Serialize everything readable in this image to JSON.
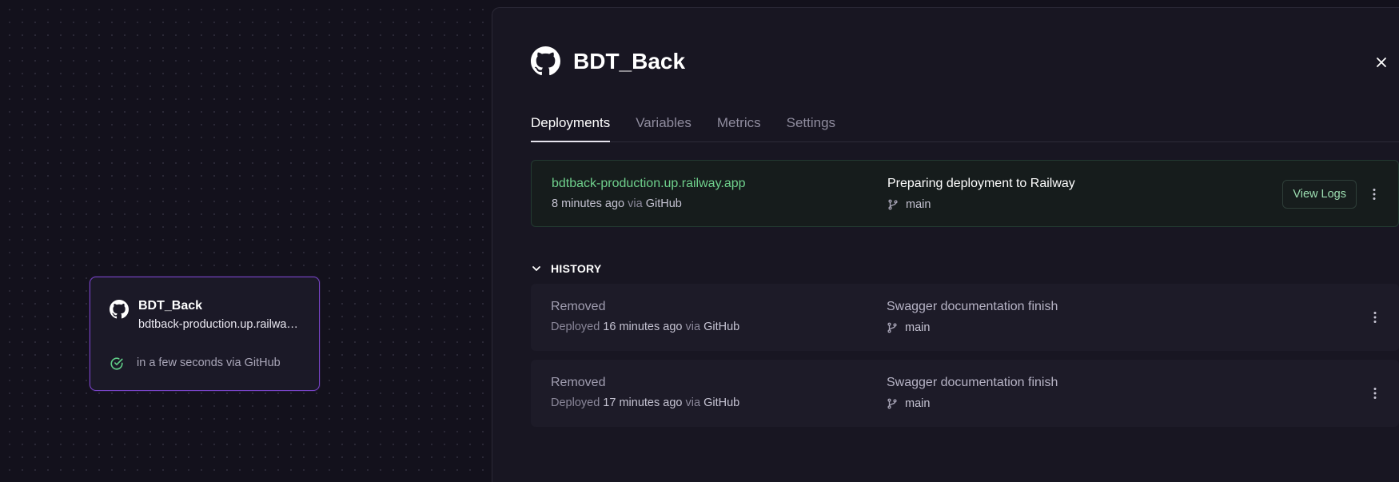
{
  "canvas": {
    "service_card": {
      "name": "BDT_Back",
      "url": "bdtback-production.up.railway.app",
      "status": "in a few seconds via GitHub",
      "icon": "github-icon",
      "status_icon": "check-circle-icon"
    }
  },
  "panel": {
    "title": "BDT_Back",
    "icon": "github-icon",
    "tabs": [
      {
        "label": "Deployments",
        "active": true
      },
      {
        "label": "Variables",
        "active": false
      },
      {
        "label": "Metrics",
        "active": false
      },
      {
        "label": "Settings",
        "active": false
      }
    ],
    "active_deployment": {
      "url": "bdtback-production.up.railway.app",
      "time": "8 minutes ago",
      "via_label": "via",
      "source": "GitHub",
      "message": "Preparing deployment to Railway",
      "branch": "main",
      "view_logs_label": "View Logs"
    },
    "history_label": "HISTORY",
    "history": [
      {
        "status": "Removed",
        "deployed_label": "Deployed",
        "time": "16 minutes ago",
        "via_label": "via",
        "source": "GitHub",
        "message": "Swagger documentation finish",
        "branch": "main"
      },
      {
        "status": "Removed",
        "deployed_label": "Deployed",
        "time": "17 minutes ago",
        "via_label": "via",
        "source": "GitHub",
        "message": "Swagger documentation finish",
        "branch": "main"
      }
    ]
  },
  "colors": {
    "background": "#13111c",
    "panel": "#181622",
    "card_border": "#7a45c9",
    "success_green": "#6fd08c"
  }
}
